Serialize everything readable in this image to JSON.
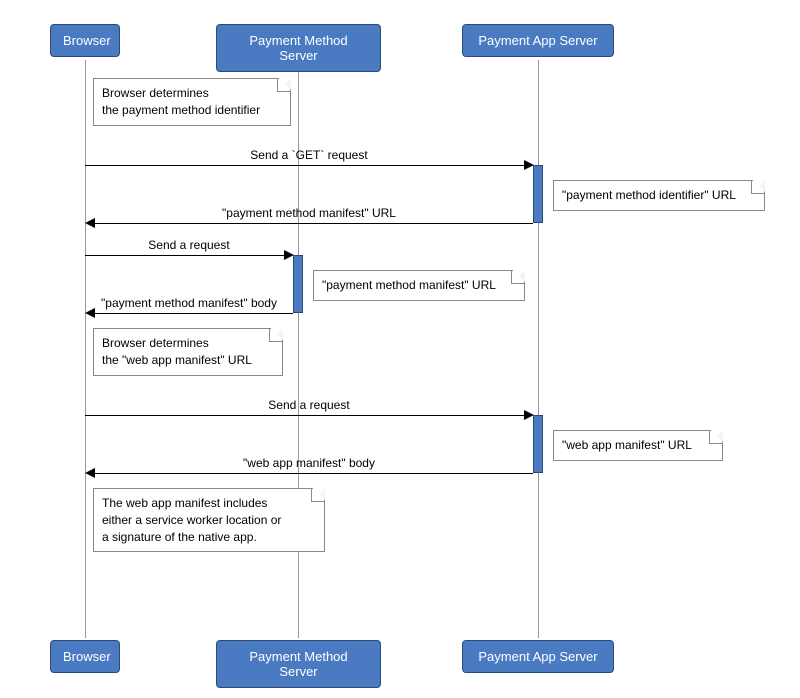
{
  "participants": {
    "browser": "Browser",
    "pms": "Payment Method Server",
    "pas": "Payment App Server"
  },
  "notes": {
    "n1_l1": "Browser determines",
    "n1_l2": "the payment method identifier",
    "n2": "\"payment method identifier\" URL",
    "n3": "\"payment method manifest\" URL",
    "n4_l1": "Browser determines",
    "n4_l2": "the \"web app manifest\" URL",
    "n5": "\"web app manifest\" URL",
    "n6_l1": "The web app manifest includes",
    "n6_l2": "either a service worker location or",
    "n6_l3": "a signature of the native app."
  },
  "messages": {
    "m1": "Send a `GET` request",
    "m2": "\"payment method manifest\" URL",
    "m3": "Send a request",
    "m4": "\"payment method manifest\" body",
    "m5": "Send a request",
    "m6": "\"web app manifest\" body"
  }
}
